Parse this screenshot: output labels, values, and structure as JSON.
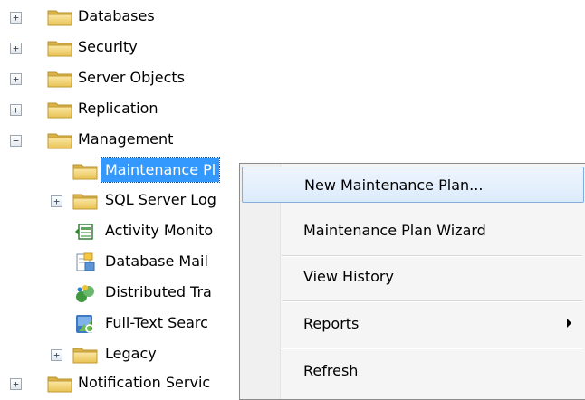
{
  "tree": {
    "items": [
      {
        "label": "Databases",
        "expander": "+"
      },
      {
        "label": "Security",
        "expander": "+"
      },
      {
        "label": "Server Objects",
        "expander": "+"
      },
      {
        "label": "Replication",
        "expander": "+"
      },
      {
        "label": "Management",
        "expander": "−"
      }
    ],
    "management_children": [
      {
        "label": "Maintenance Pl",
        "icon": "folder-icon"
      },
      {
        "label": "SQL Server Log",
        "expander": "+",
        "icon": "folder-icon"
      },
      {
        "label": "Activity Monito",
        "icon": "activity-monitor-icon"
      },
      {
        "label": "Database Mail",
        "icon": "database-mail-icon"
      },
      {
        "label": "Distributed Tra",
        "icon": "distributed-transaction-icon"
      },
      {
        "label": "Full-Text Searc",
        "icon": "full-text-search-icon"
      },
      {
        "label": "Legacy",
        "expander": "+",
        "icon": "folder-icon"
      }
    ],
    "last": {
      "label": "Notification Servic",
      "expander": "+"
    }
  },
  "context_menu": {
    "items": [
      {
        "label": "New Maintenance Plan..."
      },
      {
        "label": "Maintenance Plan Wizard"
      },
      {
        "label": "View History"
      },
      {
        "label": "Reports"
      },
      {
        "label": "Refresh"
      }
    ]
  },
  "colors": {
    "selection": "#3399ff",
    "folder": "#f2d36a",
    "menu_hover_border": "#84acdd"
  }
}
